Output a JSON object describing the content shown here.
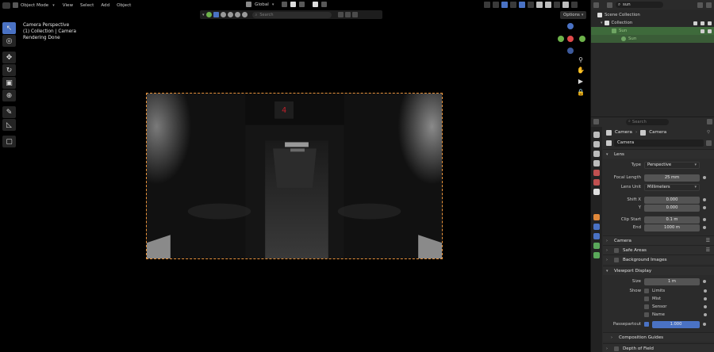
{
  "viewport": {
    "menu": [
      "View",
      "Select",
      "Add",
      "Object"
    ],
    "mode": "Object Mode",
    "transform_orientation": "Global",
    "search_placeholder": "Search",
    "options_label": "Options",
    "info_lines": [
      "Camera Perspective",
      "(1) Collection | Camera",
      "Rendering Done"
    ],
    "render_digit": "4"
  },
  "outliner": {
    "search_value": "sun",
    "rows": [
      {
        "label": "Scene Collection"
      },
      {
        "label": "Collection"
      },
      {
        "label": "Sun"
      },
      {
        "label": "Sun"
      }
    ]
  },
  "properties": {
    "search_placeholder": "Search",
    "breadcrumb": [
      "Camera",
      "Camera"
    ],
    "datablock_name": "Camera",
    "panels": {
      "lens": {
        "title": "Lens",
        "type_label": "Type",
        "type_value": "Perspective",
        "focal_label": "Focal Length",
        "focal_value": "25 mm",
        "lens_unit_label": "Lens Unit",
        "lens_unit_value": "Millimeters",
        "shift_x_label": "Shift X",
        "shift_x_value": "0.000",
        "shift_y_label": "Y",
        "shift_y_value": "0.000",
        "clip_start_label": "Clip Start",
        "clip_start_value": "0.1 m",
        "clip_end_label": "End",
        "clip_end_value": "1000 m"
      },
      "camera": {
        "title": "Camera"
      },
      "safe_areas": {
        "title": "Safe Areas"
      },
      "background_images": {
        "title": "Background Images"
      },
      "viewport_display": {
        "title": "Viewport Display",
        "size_label": "Size",
        "size_value": "1 m",
        "show_label": "Show",
        "show_items": [
          "Limits",
          "Mist",
          "Sensor",
          "Name"
        ],
        "passepartout_label": "Passepartout",
        "passepartout_value": "1.000",
        "passepartout_fill": 1.0
      },
      "composition_guides": {
        "title": "Composition Guides"
      },
      "depth_of_field": {
        "title": "Depth of Field"
      }
    }
  },
  "colors": {
    "accent": "#4a72c4",
    "frame": "#e9933b",
    "outliner_selected": "#3e6a3b",
    "x_axis": "#e04a4a",
    "y_axis": "#6db24a",
    "z_axis": "#4a72c4"
  }
}
